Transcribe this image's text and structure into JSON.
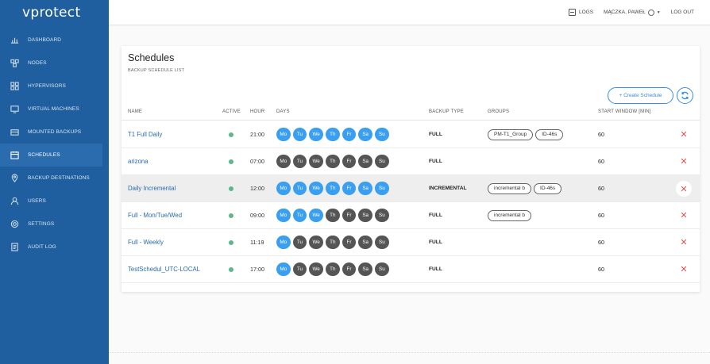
{
  "app": {
    "logo": "vprotect"
  },
  "sidebar": {
    "items": [
      {
        "label": "DASHBOARD",
        "icon": "dashboard-icon"
      },
      {
        "label": "NODES",
        "icon": "nodes-icon"
      },
      {
        "label": "HYPERVISORS",
        "icon": "hypervisors-icon"
      },
      {
        "label": "VIRTUAL MACHINES",
        "icon": "virtual-machines-icon"
      },
      {
        "label": "MOUNTED BACKUPS",
        "icon": "mounted-backups-icon"
      },
      {
        "label": "SCHEDULES",
        "icon": "calendar-icon",
        "active": true
      },
      {
        "label": "BACKUP DESTINATIONS",
        "icon": "location-icon"
      },
      {
        "label": "USERS",
        "icon": "user-icon"
      },
      {
        "label": "SETTINGS",
        "icon": "gear-icon"
      },
      {
        "label": "AUDIT LOG",
        "icon": "audit-log-icon"
      }
    ]
  },
  "topbar": {
    "logs": "LOGS",
    "user": "MĄCZKA, PAWEŁ",
    "logout": "LOG OUT"
  },
  "page": {
    "title": "Schedules",
    "subtitle": "BACKUP SCHEDULE LIST",
    "create_button": "+ Create Schedule"
  },
  "table": {
    "headers": {
      "name": "NAME",
      "active": "ACTIVE",
      "hour": "HOUR",
      "days": "DAYS",
      "backup_type": "BACKUP TYPE",
      "groups": "GROUPS",
      "start_window": "START WINDOW [MIN]"
    },
    "day_labels": [
      "Mo",
      "Tu",
      "We",
      "Th",
      "Fr",
      "Sa",
      "Su"
    ],
    "rows": [
      {
        "name": "T1 Full Daily",
        "active": true,
        "hour": "21:00",
        "days": [
          1,
          1,
          1,
          1,
          1,
          1,
          1
        ],
        "type": "FULL",
        "groups": [
          "PM-T1_Group",
          "ID-46s"
        ],
        "window": "60"
      },
      {
        "name": "arizona",
        "active": true,
        "hour": "07:00",
        "days": [
          0,
          0,
          0,
          0,
          0,
          0,
          0
        ],
        "type": "FULL",
        "groups": [],
        "window": "60"
      },
      {
        "name": "Daily Incremental",
        "active": true,
        "hour": "12:00",
        "days": [
          1,
          1,
          1,
          1,
          1,
          1,
          1
        ],
        "type": "INCREMENTAL",
        "groups": [
          "incremental b",
          "ID-46s"
        ],
        "window": "60",
        "highlight": true
      },
      {
        "name": "Full - Mon/Tue/Wed",
        "active": true,
        "hour": "09:00",
        "days": [
          1,
          1,
          1,
          0,
          0,
          0,
          0
        ],
        "type": "FULL",
        "groups": [
          "incremental b"
        ],
        "window": "60"
      },
      {
        "name": "Full - Weekly",
        "active": true,
        "hour": "11:19",
        "days": [
          1,
          0,
          0,
          0,
          0,
          0,
          0
        ],
        "type": "FULL",
        "groups": [],
        "window": "60"
      },
      {
        "name": "TestSchedul_UTC-LOCAL",
        "active": true,
        "hour": "17:00",
        "days": [
          1,
          0,
          0,
          0,
          0,
          0,
          0
        ],
        "type": "FULL",
        "groups": [],
        "window": "60"
      }
    ]
  },
  "colors": {
    "sidebar": "#1f5f9f",
    "accent": "#3a9ff0",
    "day_off": "#555555",
    "active_dot": "#5cb88a",
    "delete": "#e05050"
  }
}
